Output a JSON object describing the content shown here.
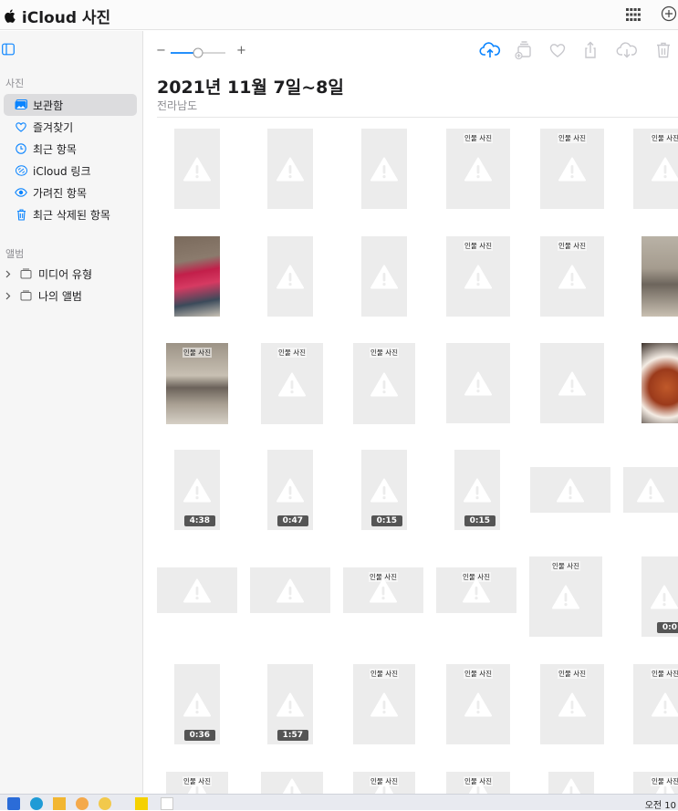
{
  "app": {
    "title": "iCloud 사진"
  },
  "sidebar": {
    "photos_section": "사진",
    "items": [
      {
        "label": "보관함",
        "icon": "library-icon",
        "active": true
      },
      {
        "label": "즐겨찾기",
        "icon": "heart-icon"
      },
      {
        "label": "최근 항목",
        "icon": "clock-icon"
      },
      {
        "label": "iCloud 링크",
        "icon": "link-icon"
      },
      {
        "label": "가려진 항목",
        "icon": "eye-icon"
      },
      {
        "label": "최근 삭제된 항목",
        "icon": "trash-icon"
      }
    ],
    "albums_section": "앨범",
    "albums": [
      {
        "label": "미디어 유형",
        "icon": "folder-icon"
      },
      {
        "label": "나의 앨범",
        "icon": "folder-icon"
      }
    ]
  },
  "toolbar": {
    "zoom_minus": "−",
    "zoom_plus": "+",
    "zoom_level": 0.5,
    "icons": [
      "upload-icon",
      "add-to-album-icon",
      "heart-icon",
      "share-icon",
      "download-icon",
      "delete-icon"
    ]
  },
  "header": {
    "date": "2021년 11월 7일~8일",
    "location": "전라남도"
  },
  "grid": {
    "badge_text": "인물 사진",
    "colors": {
      "accent": "#0a84ff",
      "tile": "#ececec"
    },
    "durations": [
      "4:38",
      "0:47",
      "0:15",
      "0:15",
      "0:0",
      "0:36",
      "1:57"
    ]
  },
  "status": {
    "clock": "오전 10"
  }
}
